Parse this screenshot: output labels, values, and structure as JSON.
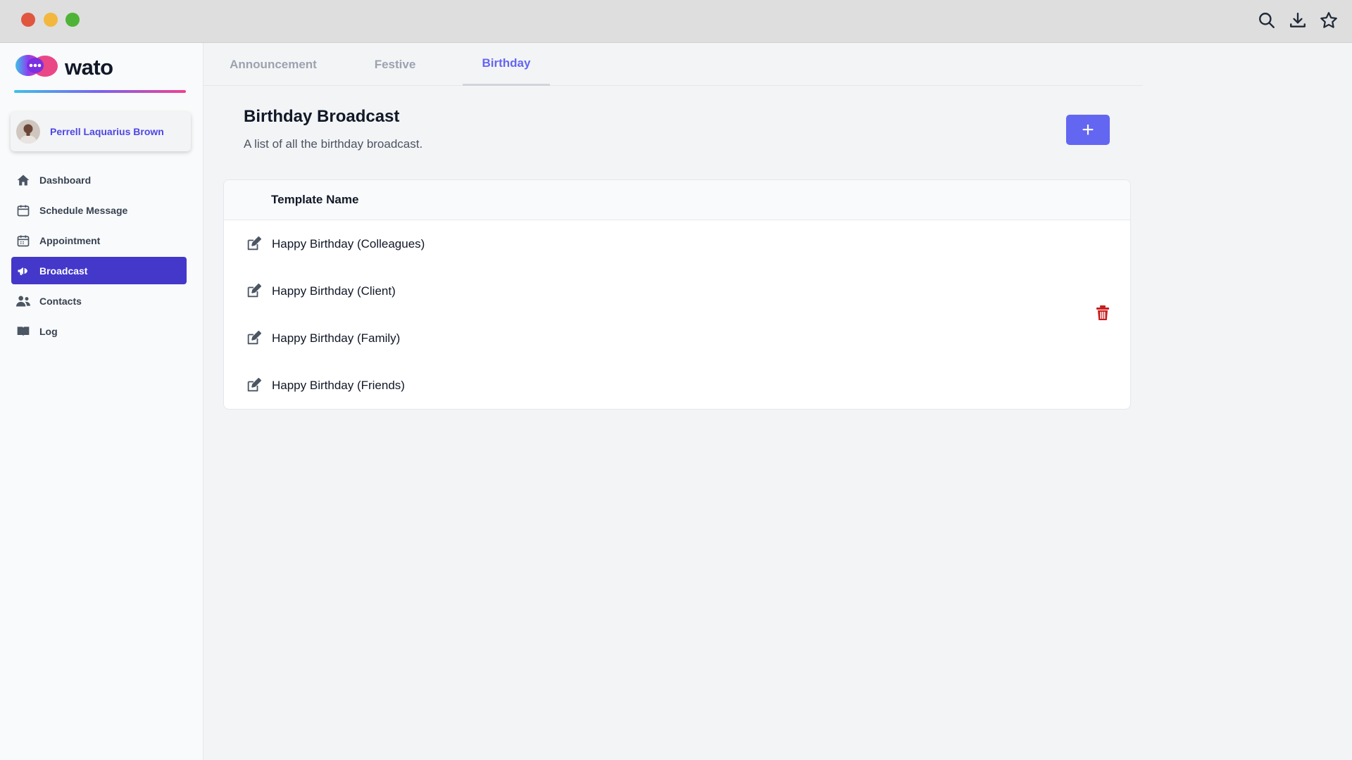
{
  "window": {
    "controls": [
      "close",
      "minimize",
      "maximize"
    ],
    "toolbar_icons": [
      "search-icon",
      "download-icon",
      "star-icon"
    ]
  },
  "brand": {
    "name": "wato",
    "logo_icon": "chat-bubble-logo-icon",
    "accent_color": "#6366f1"
  },
  "user": {
    "name": "Perrell Laquarius Brown",
    "avatar_icon": "user-avatar"
  },
  "sidebar": {
    "items": [
      {
        "label": "Dashboard",
        "icon": "home-icon",
        "active": false
      },
      {
        "label": "Schedule Message",
        "icon": "calendar-icon",
        "active": false
      },
      {
        "label": "Appointment",
        "icon": "calendar-clock-icon",
        "active": false
      },
      {
        "label": "Broadcast",
        "icon": "megaphone-icon",
        "active": true
      },
      {
        "label": "Contacts",
        "icon": "users-icon",
        "active": false
      },
      {
        "label": "Log",
        "icon": "book-icon",
        "active": false
      }
    ],
    "active_color": "#4338ca"
  },
  "tabs": [
    {
      "label": "Announcement",
      "active": false
    },
    {
      "label": "Festive",
      "active": false
    },
    {
      "label": "Birthday",
      "active": true
    }
  ],
  "main": {
    "title": "Birthday Broadcast",
    "subtitle": "A list of all the birthday broadcast.",
    "add_button_label": "+",
    "table": {
      "header": "Template Name",
      "rows": [
        "Happy Birthday (Colleagues)",
        "Happy Birthday (Client)",
        "Happy Birthday (Family)",
        "Happy Birthday (Friends)"
      ]
    },
    "delete_icon": "trash-icon",
    "delete_color": "#c81e1e"
  }
}
